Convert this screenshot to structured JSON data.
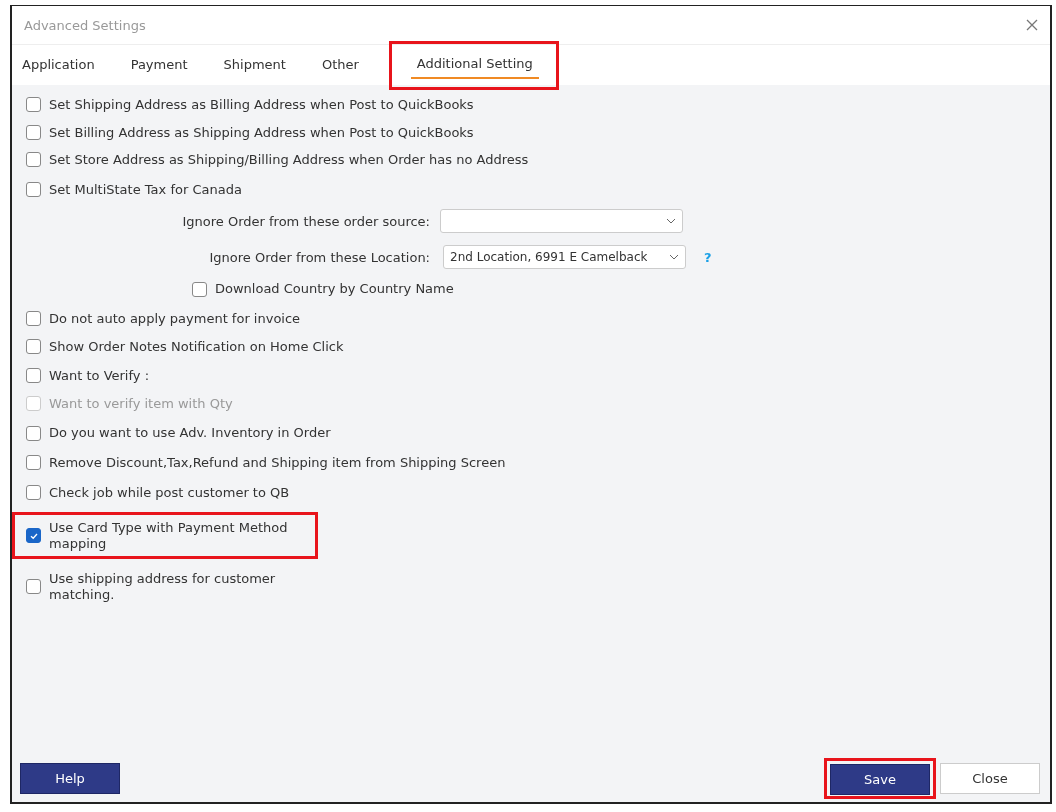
{
  "window": {
    "title": "Advanced Settings"
  },
  "tabs": [
    {
      "label": "Application",
      "selected": false,
      "highlighted": false
    },
    {
      "label": "Payment",
      "selected": false,
      "highlighted": false
    },
    {
      "label": "Shipment",
      "selected": false,
      "highlighted": false
    },
    {
      "label": "Other",
      "selected": false,
      "highlighted": false
    },
    {
      "label": "Additional Setting",
      "selected": true,
      "highlighted": true
    }
  ],
  "groups": [
    [
      {
        "kind": "checkbox",
        "label": "Set Shipping Address as Billing Address when Post to QuickBooks",
        "checked": false,
        "disabled": false,
        "highlighted": false
      },
      {
        "kind": "checkbox",
        "label": "Set Billing Address as Shipping Address when Post to QuickBooks",
        "checked": false,
        "disabled": false,
        "highlighted": false
      },
      {
        "kind": "checkbox",
        "label": "Set Store Address as Shipping/Billing Address when Order has no Address",
        "checked": false,
        "disabled": false,
        "highlighted": false
      }
    ],
    [
      {
        "kind": "checkbox",
        "label": "Set MultiState Tax for Canada",
        "checked": false,
        "disabled": false,
        "highlighted": false
      },
      {
        "kind": "select",
        "label": "Ignore Order from these order source:"
      },
      {
        "kind": "select",
        "label": "Ignore Order from these  Location:",
        "value": "2nd Location, 6991 E Camelback",
        "help_text": "?"
      },
      {
        "kind": "sub_checkbox",
        "label": "Download Country by Country Name",
        "checked": false,
        "disabled": false,
        "highlighted": false
      }
    ],
    [
      {
        "kind": "checkbox",
        "label": "Do not auto apply payment for invoice",
        "checked": false,
        "disabled": false,
        "highlighted": false
      },
      {
        "kind": "checkbox",
        "label": "Show Order Notes Notification on Home Click",
        "checked": false,
        "disabled": false,
        "highlighted": false
      }
    ],
    [
      {
        "kind": "checkbox",
        "label": "Want to Verify :",
        "checked": false,
        "disabled": false,
        "highlighted": false
      },
      {
        "kind": "checkbox",
        "label": "Want to verify item with Qty",
        "checked": false,
        "disabled": true,
        "highlighted": false
      }
    ],
    [
      {
        "kind": "checkbox",
        "label": "Do you want to use Adv. Inventory in Order",
        "checked": false,
        "disabled": false,
        "highlighted": false
      }
    ],
    [
      {
        "kind": "checkbox",
        "label": "Remove Discount,Tax,Refund and Shipping item from Shipping Screen",
        "checked": false,
        "disabled": false,
        "highlighted": false
      }
    ],
    [
      {
        "kind": "checkbox",
        "label": "Check job while post customer to QB",
        "checked": false,
        "disabled": false,
        "highlighted": false
      },
      {
        "kind": "narrow_checkbox",
        "label": "Use Card Type with Payment Method mapping",
        "checked": true,
        "disabled": false,
        "highlighted": true
      },
      {
        "kind": "narrow_checkbox",
        "label": "Use shipping address for customer matching.",
        "checked": false,
        "disabled": false,
        "highlighted": false
      }
    ]
  ],
  "buttons": [
    {
      "label": "Help",
      "kind": "primary",
      "highlighted": false
    },
    {
      "label": "Save",
      "kind": "primary",
      "highlighted": true
    },
    {
      "label": "Close",
      "kind": "secondary",
      "highlighted": false
    }
  ]
}
